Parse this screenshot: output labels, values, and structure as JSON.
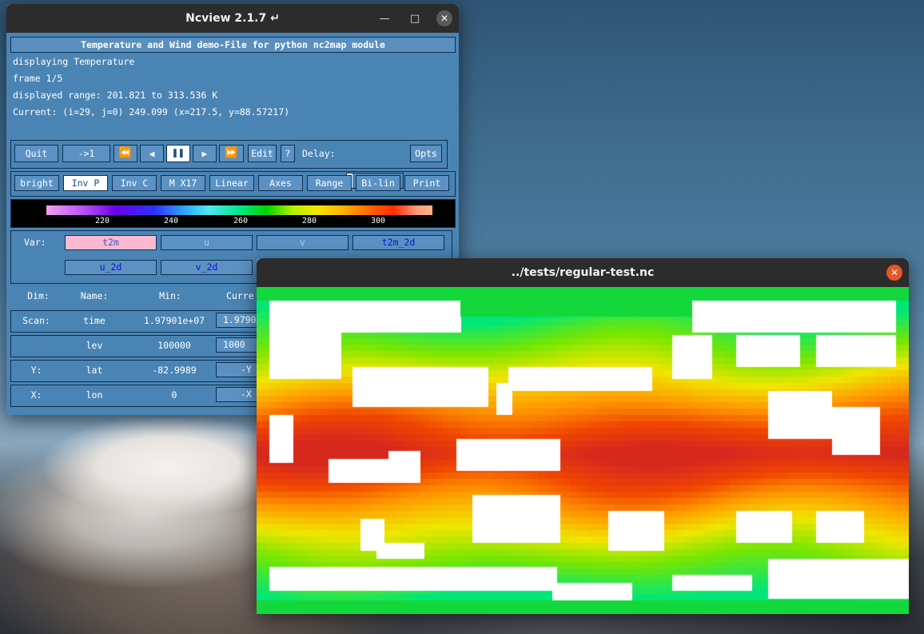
{
  "ncview_window": {
    "title": "Ncview 2.1.7 ↵",
    "file_title": "Temperature and Wind demo-File for python nc2map module",
    "displaying": "displaying Temperature",
    "frame": "frame 1/5",
    "range": "displayed range: 201.821 to 313.536 K",
    "current": "Current: (i=29, j=0) 249.099 (x=217.5, y=88.57217)",
    "controls": {
      "quit": "Quit",
      "to_first": "->1",
      "edit": "Edit",
      "help": "?",
      "delay_label": "Delay:",
      "opts": "Opts",
      "delay_level": 0
    },
    "options": [
      "bright",
      "Inv P",
      "Inv C",
      "M X17",
      "Linear",
      "Axes",
      "Range",
      "Bi-lin",
      "Print"
    ],
    "colorbar_ticks": [
      "220",
      "240",
      "260",
      "280",
      "300"
    ],
    "var_label": "Var:",
    "vars": [
      "t2m",
      "u",
      "v",
      "t2m_2d",
      "u_2d",
      "v_2d"
    ],
    "dim_headers": {
      "dim": "Dim:",
      "name": "Name:",
      "min": "Min:",
      "current": "Curre"
    },
    "dims": [
      {
        "dim": "Scan:",
        "name": "time",
        "min": "1.97901e+07",
        "current": "1.9790"
      },
      {
        "dim": "",
        "name": "lev",
        "min": "100000",
        "current": "1000"
      },
      {
        "dim": "Y:",
        "name": "lat",
        "min": "-82.9989",
        "current": "-Y"
      },
      {
        "dim": "X:",
        "name": "lon",
        "min": "0",
        "current": "-X"
      }
    ]
  },
  "map_window": {
    "title": "../tests/regular-test.nc"
  },
  "colors": {
    "titlebar": "#2c2c2c",
    "panel_bg": "#4a84b4",
    "close_active": "#e95420",
    "selected_var": "#fbb8cf"
  }
}
